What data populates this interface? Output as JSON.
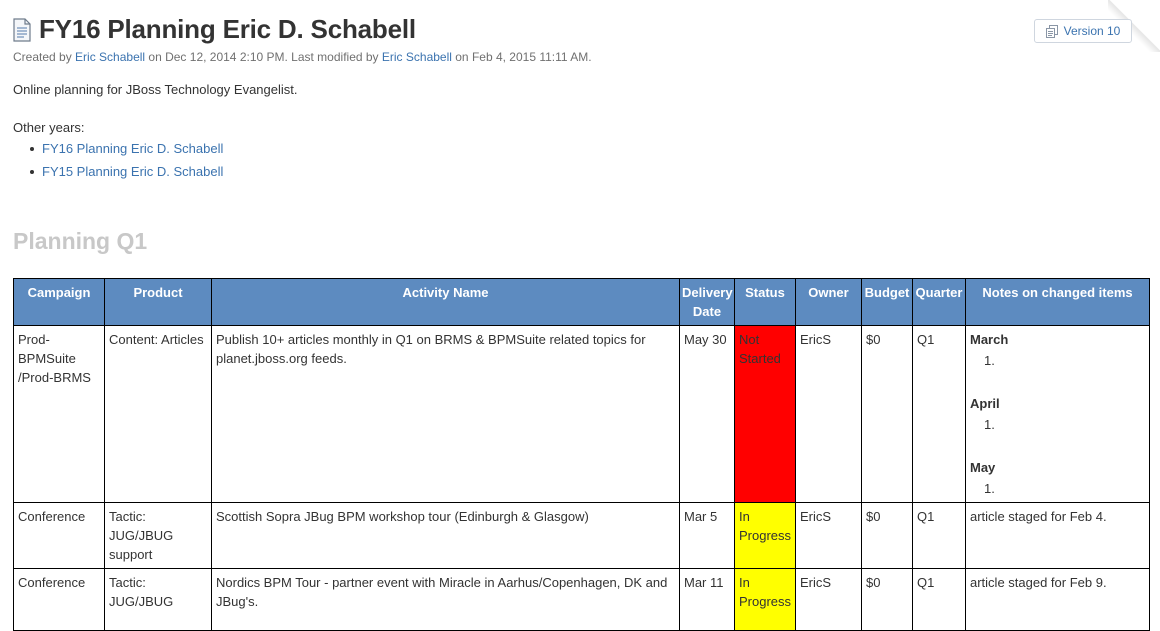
{
  "page": {
    "title": "FY16 Planning Eric D. Schabell",
    "meta": {
      "created_prefix": "Created by ",
      "creator": "Eric Schabell",
      "created_on": " on Dec 12, 2014 2:10 PM. Last modified by ",
      "modifier": "Eric Schabell",
      "modified_on": " on Feb 4, 2015 11:11 AM."
    },
    "version_label": "Version 10",
    "intro": "Online planning for JBoss Technology Evangelist.",
    "other_years_label": "Other years:",
    "other_years": [
      "FY16 Planning Eric D. Schabell",
      "FY15 Planning Eric D. Schabell"
    ],
    "section_heading": "Planning Q1"
  },
  "table": {
    "headers": [
      "Campaign",
      "Product",
      "Activity Name",
      "Delivery Date",
      "Status",
      "Owner",
      "Budget",
      "Quarter",
      "Notes on changed items"
    ],
    "rows": [
      {
        "campaign": "Prod-BPMSuite /Prod-BRMS",
        "product": "Content: Articles",
        "activity": "Publish 10+ articles monthly in Q1 on BRMS & BPMSuite related topics for planet.jboss.org feeds.",
        "date": "May 30",
        "status": "Not Started",
        "owner": "EricS",
        "budget": "$0",
        "quarter": "Q1",
        "notes": {
          "m1": "March",
          "m2": "April",
          "m3": "May",
          "item": "1."
        }
      },
      {
        "campaign": "Conference",
        "product": "Tactic: JUG/JBUG support",
        "activity": "Scottish Sopra JBug BPM workshop tour (Edinburgh & Glasgow)",
        "date": "Mar 5",
        "status": "In Progress",
        "owner": "EricS",
        "budget": "$0",
        "quarter": "Q1",
        "notes_text": "article staged for Feb 4."
      },
      {
        "campaign": "Conference",
        "product": "Tactic: JUG/JBUG",
        "activity": "Nordics BPM Tour - partner event with Miracle in Aarhus/Copenhagen, DK and JBug's.",
        "date": "Mar 11",
        "status": "In Progress",
        "owner": "EricS",
        "budget": "$0",
        "quarter": "Q1",
        "notes_text": "article staged for Feb 9."
      }
    ]
  },
  "colors": {
    "header_bg": "#5d8bc0",
    "status_not_started": "#ff0000",
    "status_in_progress": "#ffff00",
    "link": "#3b73af"
  }
}
